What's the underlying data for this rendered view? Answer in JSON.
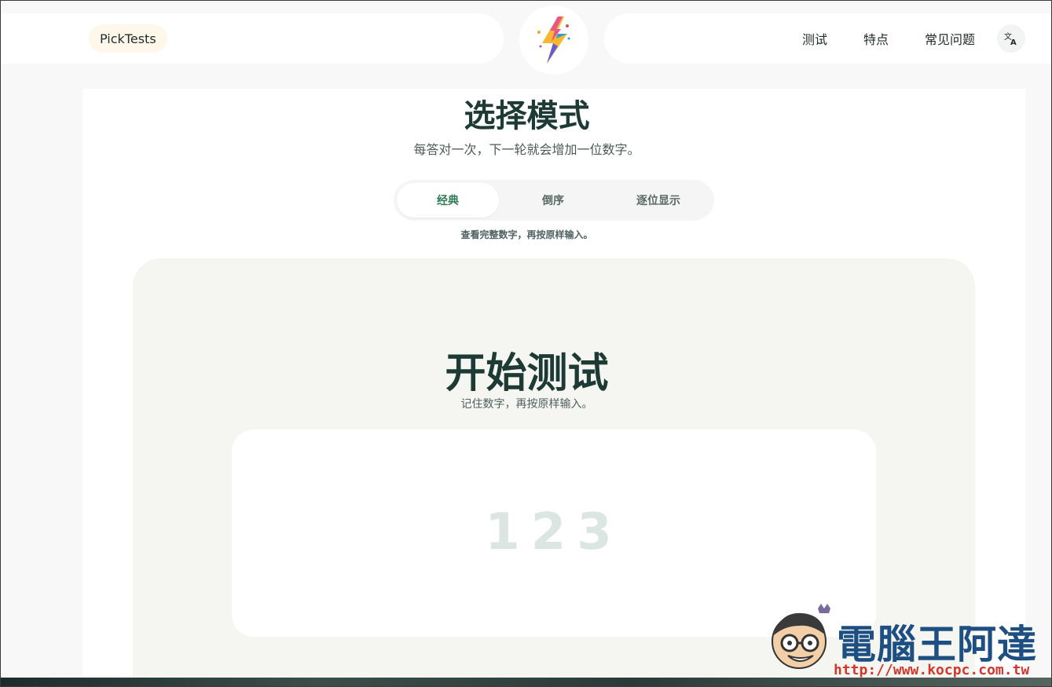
{
  "header": {
    "brand": "PickTests",
    "nav": [
      "测试",
      "特点",
      "常见问题"
    ],
    "logo_icon": "lightning-bolt-icon",
    "lang_icon": "translate-icon"
  },
  "mode_section": {
    "title": "选择模式",
    "subtitle": "每答对一次，下一轮就会增加一位数字。",
    "tabs": [
      {
        "label": "经典",
        "active": true
      },
      {
        "label": "倒序",
        "active": false
      },
      {
        "label": "逐位显示",
        "active": false
      }
    ],
    "hint": "查看完整数字，再按原样输入。"
  },
  "test_section": {
    "title": "开始测试",
    "subtitle": "记住数字，再按原样输入。",
    "digits": "123"
  },
  "watermark": {
    "text": "電腦王阿達",
    "url": "http://www.kocpc.com.tw"
  },
  "colors": {
    "accent": "#2f7a57",
    "heading": "#1d3a34",
    "digits": "#dbe6e2"
  }
}
